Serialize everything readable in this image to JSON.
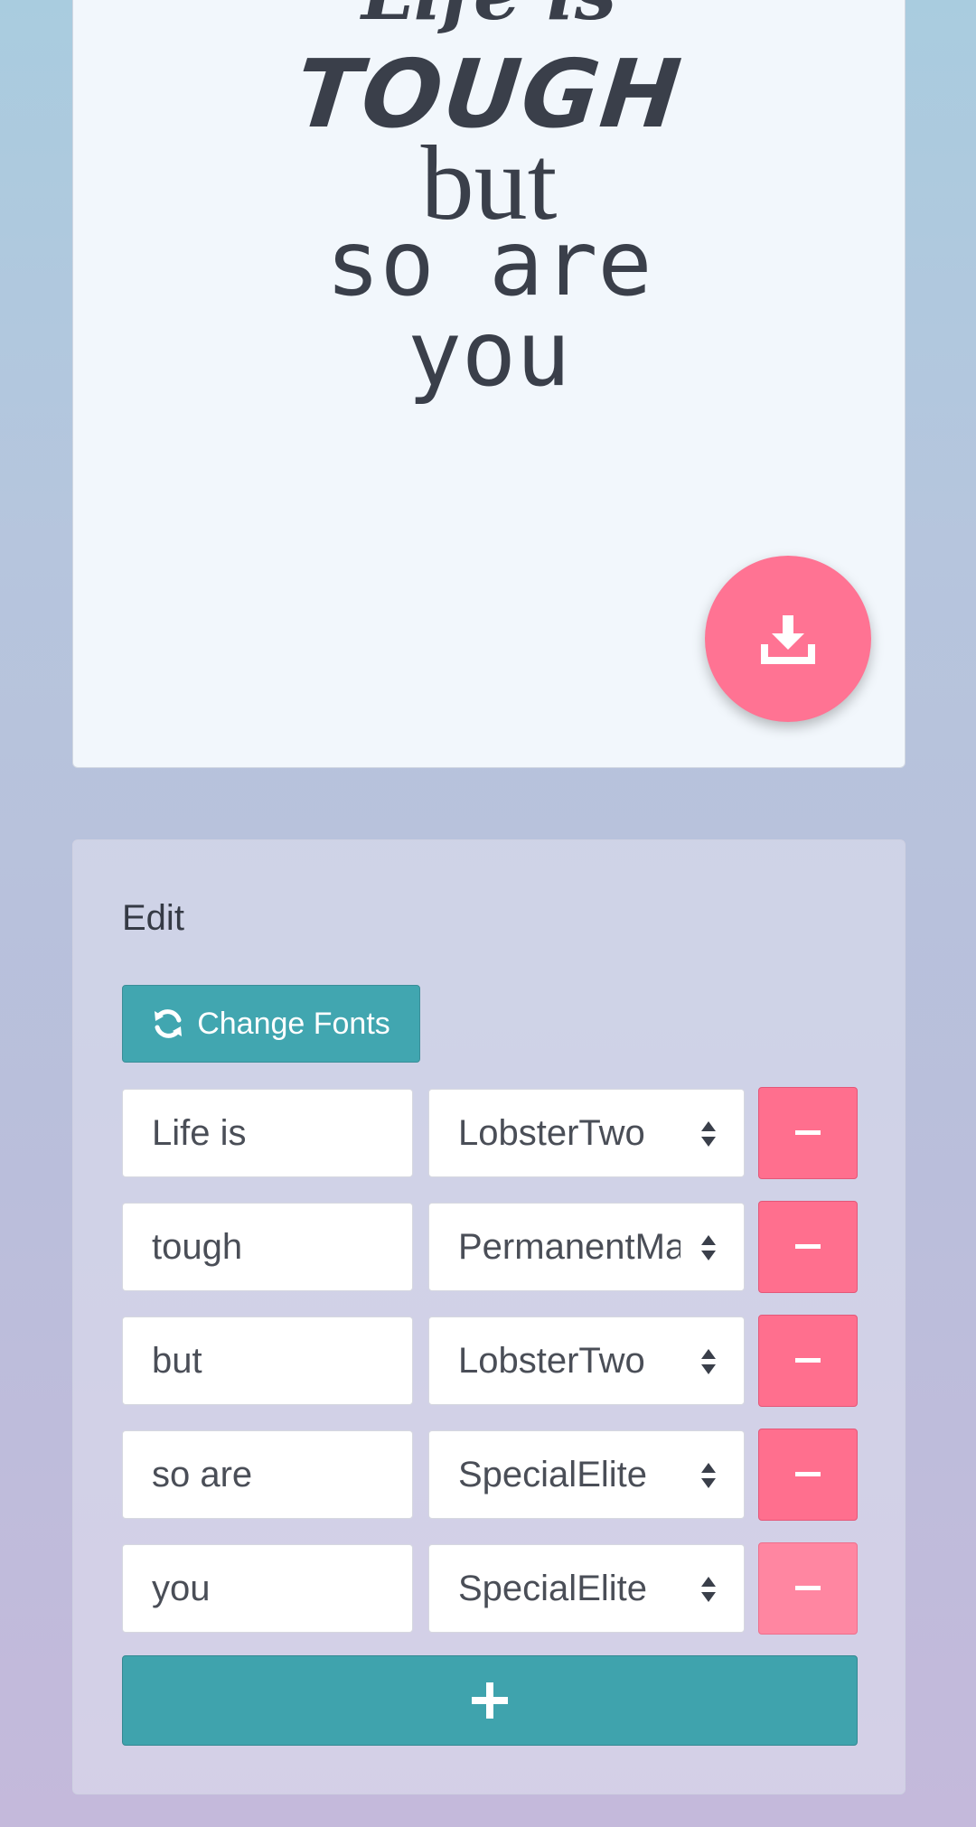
{
  "poster": {
    "lines": [
      {
        "text": "Life is",
        "font": "LobsterTwo"
      },
      {
        "text": "tough",
        "font": "PermanentMarker"
      },
      {
        "text": "but",
        "font": "LobsterTwo"
      },
      {
        "text": "so are",
        "font": "SpecialElite"
      },
      {
        "text": "you",
        "font": "SpecialElite"
      }
    ]
  },
  "download": {
    "icon": "download-icon",
    "color": "#ff7393"
  },
  "editor": {
    "title": "Edit",
    "change_fonts_label": "Change Fonts",
    "change_fonts_icon": "refresh-icon",
    "rows": [
      {
        "text": "Life is",
        "font": "LobsterTwo"
      },
      {
        "text": "tough",
        "font": "PermanentMarker"
      },
      {
        "text": "but",
        "font": "LobsterTwo"
      },
      {
        "text": "so are",
        "font": "SpecialElite"
      },
      {
        "text": "you",
        "font": "SpecialElite"
      }
    ],
    "remove_icon": "minus-icon",
    "add_icon": "plus-icon"
  },
  "colors": {
    "accent_teal": "#41a6b0",
    "accent_pink": "#ff6f8e",
    "text_dark": "#3a3f4a"
  }
}
